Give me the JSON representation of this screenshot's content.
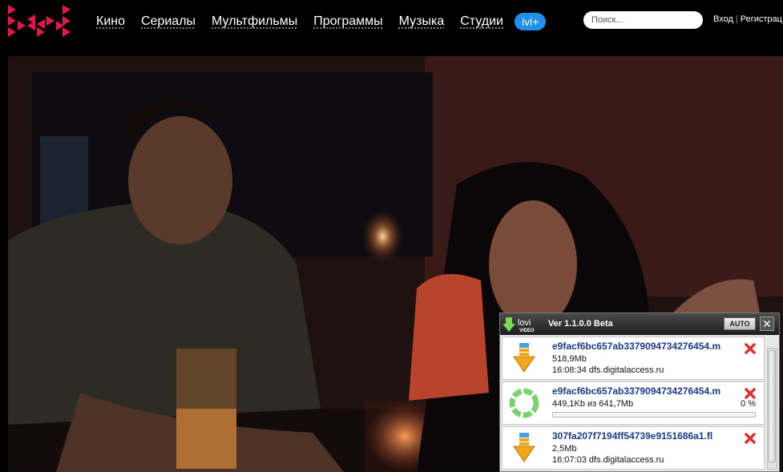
{
  "header": {
    "nav": [
      "Кино",
      "Сериалы",
      "Мультфильмы",
      "Программы",
      "Музыка",
      "Студии"
    ],
    "ivi_plus": "ivi+",
    "search_placeholder": "Поиск...",
    "login": "Вход",
    "register": "Регистрац",
    "separator": "|",
    "logo_color": "#e5174a",
    "pill_color": "#1e90e8"
  },
  "lovi": {
    "logo_text": "lovi",
    "logo_sub": "VIDEO",
    "version": "Ver 1.1.0.0 Beta",
    "auto_label": "AUTO",
    "close_icon": "close-icon",
    "downloads": [
      {
        "filename": "e9facf6bc657ab3379094734276454.m",
        "size": "518,9Mb",
        "info": "16:08:34 dfs.digitalaccess.ru",
        "status": "done",
        "icon": "download-arrow-icon"
      },
      {
        "filename": "e9facf6bc657ab3379094734276454.m",
        "size": "449,1Kb из 641,7Mb",
        "percent": "0 %",
        "progress": 0,
        "status": "downloading",
        "icon": "progress-ring-icon"
      },
      {
        "filename": "307fa207f7194ff54739e9151686a1.fl",
        "size": "2,5Mb",
        "info": "16:07:03 dfs.digitalaccess.ru",
        "status": "done",
        "icon": "download-arrow-icon"
      }
    ]
  }
}
